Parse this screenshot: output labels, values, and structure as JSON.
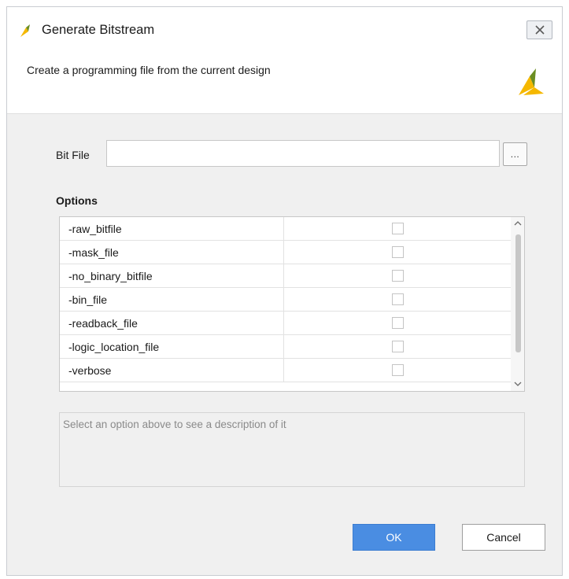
{
  "dialog": {
    "title": "Generate Bitstream",
    "subtitle": "Create a programming file from the current design",
    "icons": {
      "app": "vivado-logo-icon",
      "close": "close-icon",
      "brand": "vivado-logo-icon"
    }
  },
  "bitfile": {
    "label": "Bit File",
    "value": "",
    "placeholder": "",
    "browse_label": "..."
  },
  "options": {
    "heading": "Options",
    "items": [
      {
        "name": "-raw_bitfile",
        "checked": false
      },
      {
        "name": "-mask_file",
        "checked": false
      },
      {
        "name": "-no_binary_bitfile",
        "checked": false
      },
      {
        "name": "-bin_file",
        "checked": false
      },
      {
        "name": "-readback_file",
        "checked": false
      },
      {
        "name": "-logic_location_file",
        "checked": false
      },
      {
        "name": "-verbose",
        "checked": false
      }
    ],
    "description_placeholder": "Select an option above to see a description of it"
  },
  "buttons": {
    "ok": "OK",
    "cancel": "Cancel"
  },
  "colors": {
    "accent": "#4a8de2",
    "brand_yellow": "#f5b800",
    "brand_green": "#6b8e23"
  }
}
